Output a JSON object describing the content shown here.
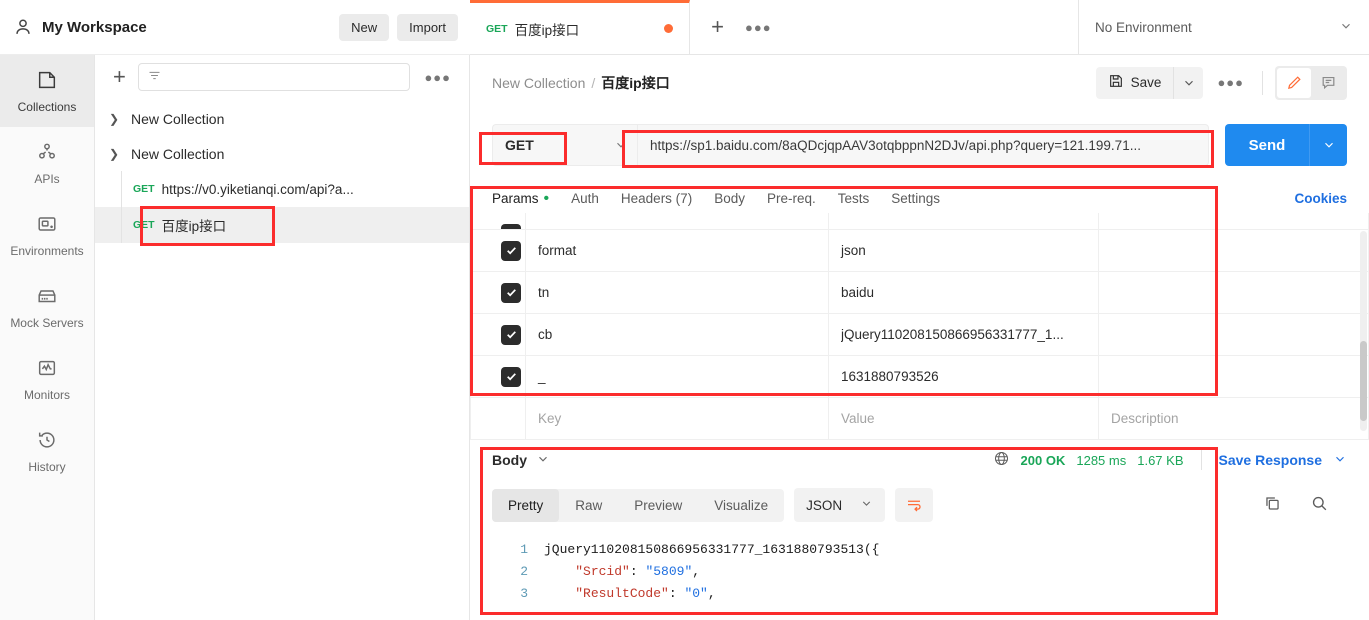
{
  "workspace": {
    "title": "My Workspace",
    "new_label": "New",
    "import_label": "Import"
  },
  "rail": {
    "items": [
      {
        "label": "Collections",
        "icon": "collections-icon",
        "active": true
      },
      {
        "label": "APIs",
        "icon": "apis-icon",
        "active": false
      },
      {
        "label": "Environments",
        "icon": "environments-icon",
        "active": false
      },
      {
        "label": "Mock Servers",
        "icon": "mock-servers-icon",
        "active": false
      },
      {
        "label": "Monitors",
        "icon": "monitors-icon",
        "active": false
      },
      {
        "label": "History",
        "icon": "history-icon",
        "active": false
      }
    ]
  },
  "sidebar": {
    "add_label": "+",
    "filter_placeholder": "",
    "more_label": "●●●",
    "tree": [
      {
        "type": "collection",
        "label": "New Collection",
        "expanded": false
      },
      {
        "type": "collection",
        "label": "New Collection",
        "expanded": true
      },
      {
        "type": "request",
        "method": "GET",
        "label": "https://v0.yiketianqi.com/api?a...",
        "selected": false
      },
      {
        "type": "request",
        "method": "GET",
        "label": "百度ip接口",
        "selected": true
      }
    ]
  },
  "tabbar": {
    "tabs": [
      {
        "method": "GET",
        "label": "百度ip接口",
        "unsaved": true,
        "active": true
      }
    ],
    "add_label": "+",
    "more_label": "●●●",
    "environment": "No Environment"
  },
  "breadcrumb": {
    "collection": "New Collection",
    "separator": "/",
    "request": "百度ip接口",
    "save_label": "Save",
    "more_label": "●●●"
  },
  "request": {
    "method": "GET",
    "url": "https://sp1.baidu.com/8aQDcjqpAAV3otqbppnN2DJv/api.php?query=121.199.71...",
    "send_label": "Send"
  },
  "request_tabs": {
    "items": [
      {
        "label": "Params",
        "active": true,
        "dot": true
      },
      {
        "label": "Auth",
        "active": false,
        "dot": false
      },
      {
        "label": "Headers (7)",
        "active": false,
        "dot": false
      },
      {
        "label": "Body",
        "active": false,
        "dot": false
      },
      {
        "label": "Pre-req.",
        "active": false,
        "dot": false
      },
      {
        "label": "Tests",
        "active": false,
        "dot": false
      },
      {
        "label": "Settings",
        "active": false,
        "dot": false
      }
    ],
    "cookies_label": "Cookies"
  },
  "params": {
    "rows": [
      {
        "checked": true,
        "key": "format",
        "value": "json",
        "description": ""
      },
      {
        "checked": true,
        "key": "tn",
        "value": "baidu",
        "description": ""
      },
      {
        "checked": true,
        "key": "cb",
        "value": "jQuery110208150866956331777_1...",
        "description": ""
      },
      {
        "checked": true,
        "key": "_",
        "value": "1631880793526",
        "description": ""
      }
    ],
    "placeholders": {
      "key": "Key",
      "value": "Value",
      "description": "Description"
    }
  },
  "response": {
    "title": "Body",
    "status": "200 OK",
    "time": "1285 ms",
    "size": "1.67 KB",
    "save_response_label": "Save Response",
    "format_tabs": [
      {
        "label": "Pretty",
        "active": true
      },
      {
        "label": "Raw",
        "active": false
      },
      {
        "label": "Preview",
        "active": false
      },
      {
        "label": "Visualize",
        "active": false
      }
    ],
    "language": "JSON",
    "code_lines": [
      {
        "num": "1",
        "fn": "jQuery110208150866956331777_1631880793513(",
        "pun": "{",
        "key": "",
        "val": ""
      },
      {
        "num": "2",
        "fn": "",
        "pun": "",
        "key": "\"Srcid\"",
        "val": "\"5809\""
      },
      {
        "num": "3",
        "fn": "",
        "pun": "",
        "key": "\"ResultCode\"",
        "val": "\"0\""
      }
    ]
  },
  "colors": {
    "accent": "#ff6c37",
    "send_blue": "#1f8aef",
    "link_blue": "#1f6fe0",
    "method_green": "#1aa658",
    "annotation_red": "#fb2c2c"
  }
}
